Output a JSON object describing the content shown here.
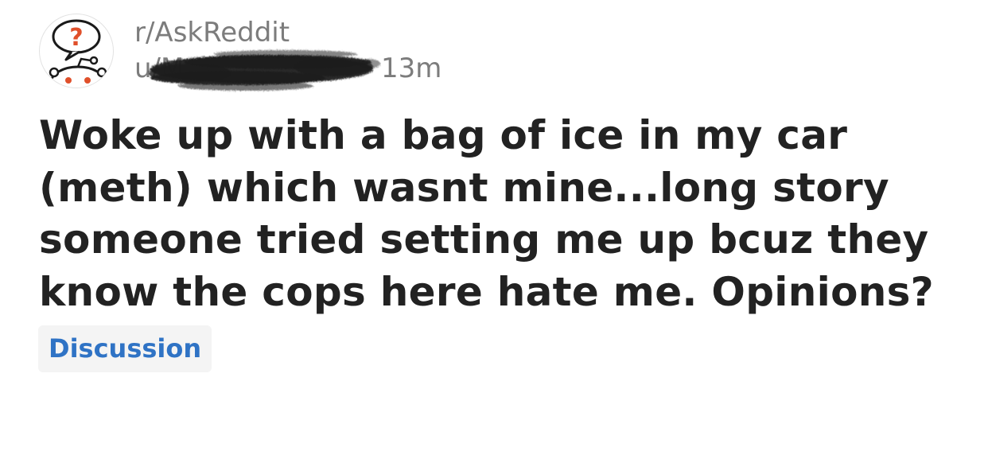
{
  "post": {
    "subreddit": "r/AskReddit",
    "username": "u/M",
    "age": "13m",
    "title": "Woke up with a bag of ice in my car (meth) which wasnt mine...long story someone tried setting me up bcuz they know the cops here hate me. Opinions?",
    "flair": "Discussion"
  },
  "icons": {
    "subreddit_avatar": "askreddit-snoo-question-icon"
  },
  "colors": {
    "title": "#222222",
    "meta": "#7c7c7c",
    "flair_text": "#2f73c5",
    "flair_bg": "#f4f4f4",
    "question_mark": "#e0502b"
  }
}
